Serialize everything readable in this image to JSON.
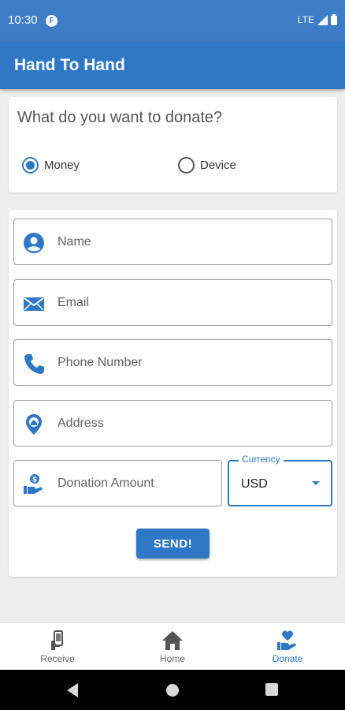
{
  "status_bar": {
    "time": "10:30",
    "notification_icon": "F",
    "network": "LTE"
  },
  "app_bar": {
    "title": "Hand To Hand"
  },
  "donation_type": {
    "question": "What do you want to donate?",
    "options": [
      {
        "label": "Money",
        "selected": true
      },
      {
        "label": "Device",
        "selected": false
      }
    ]
  },
  "form": {
    "name_placeholder": "Name",
    "email_placeholder": "Email",
    "phone_placeholder": "Phone Number",
    "address_placeholder": "Address",
    "amount_placeholder": "Donation Amount",
    "currency": {
      "label": "Currency",
      "value": "USD"
    },
    "send_label": "SEND!"
  },
  "bottom_nav": {
    "items": [
      {
        "label": "Receive",
        "icon": "hand-phone-icon",
        "active": false
      },
      {
        "label": "Home",
        "icon": "home-icon",
        "active": false
      },
      {
        "label": "Donate",
        "icon": "donate-heart-icon",
        "active": true
      }
    ]
  },
  "colors": {
    "primary": "#2f78c6",
    "status_bar": "#3d7cc6"
  }
}
